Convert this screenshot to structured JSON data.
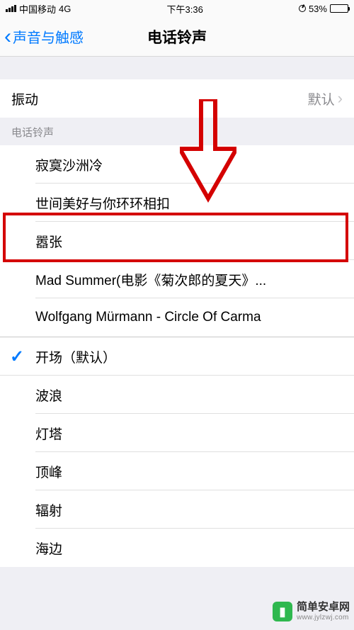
{
  "status": {
    "carrier": "中国移动",
    "network": "4G",
    "time": "下午3:36",
    "battery_pct": "53%"
  },
  "nav": {
    "back_label": "声音与触感",
    "title": "电话铃声"
  },
  "vibration": {
    "label": "振动",
    "value": "默认"
  },
  "sections": {
    "ringtones_header": "电话铃声",
    "custom": [
      "寂寞沙洲冷",
      "世间美好与你环环相扣",
      "嚣张",
      "Mad Summer(电影《菊次郎的夏天》...",
      "Wolfgang Mürmann - Circle Of Carma"
    ],
    "builtin": [
      "开场（默认）",
      "波浪",
      "灯塔",
      "顶峰",
      "辐射",
      "海边"
    ],
    "selected_index": 0
  },
  "watermark": {
    "title": "简单安卓网",
    "url": "www.jylzwj.com"
  }
}
